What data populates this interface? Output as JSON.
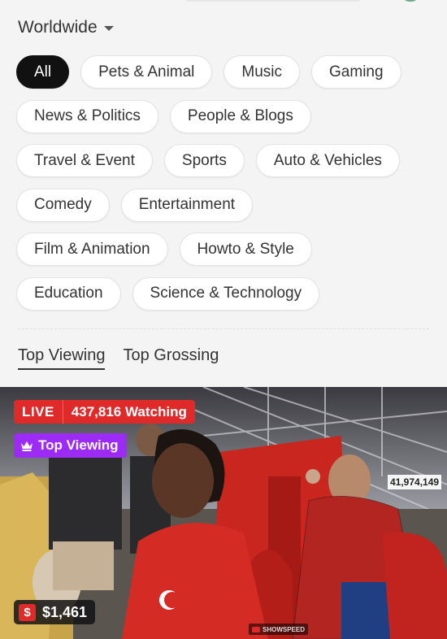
{
  "region": {
    "label": "Worldwide"
  },
  "categories": [
    [
      "All",
      "Pets & Animal",
      "Music",
      "Gaming"
    ],
    [
      "News & Politics",
      "People & Blogs"
    ],
    [
      "Travel & Event",
      "Sports",
      "Auto & Vehicles"
    ],
    [
      "Comedy",
      "Entertainment"
    ],
    [
      "Film & Animation",
      "Howto & Style"
    ],
    [
      "Education",
      "Science & Technology"
    ]
  ],
  "active_category": "All",
  "tabs": [
    {
      "label": "Top Viewing",
      "active": true
    },
    {
      "label": "Top Grossing",
      "active": false
    }
  ],
  "stream": {
    "live_label": "LIVE",
    "watching": "437,816 Watching",
    "rank_badge": "Top Viewing",
    "earnings": "$1,461",
    "currency_icon": "$",
    "overlay_counter": "41,974,149",
    "watermark": "SHOWSPEED"
  },
  "colors": {
    "live_red": "#e02a2a",
    "badge_purple": "#9b2bf5",
    "active_chip": "#111111"
  },
  "icons": [
    "chevron-down-icon",
    "crown-icon",
    "dollar-icon",
    "youtube-icon"
  ]
}
